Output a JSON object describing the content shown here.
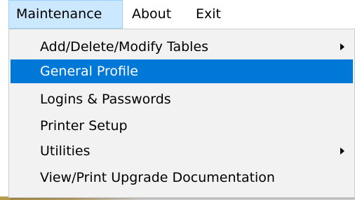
{
  "menubar": {
    "items": [
      {
        "label": "Maintenance"
      },
      {
        "label": "About"
      },
      {
        "label": "Exit"
      }
    ]
  },
  "maintenance_menu": {
    "items": [
      {
        "label": "Add/Delete/Modify Tables",
        "submenu": true
      },
      {
        "label": "General Profile",
        "selected": true
      },
      {
        "label": "Logins & Passwords"
      },
      {
        "label": "Printer Setup"
      },
      {
        "label": "Utilities",
        "submenu": true
      },
      {
        "label": "View/Print Upgrade Documentation"
      }
    ]
  },
  "colors": {
    "highlight": "#0078d7",
    "menubar_active": "#cce8ff"
  }
}
